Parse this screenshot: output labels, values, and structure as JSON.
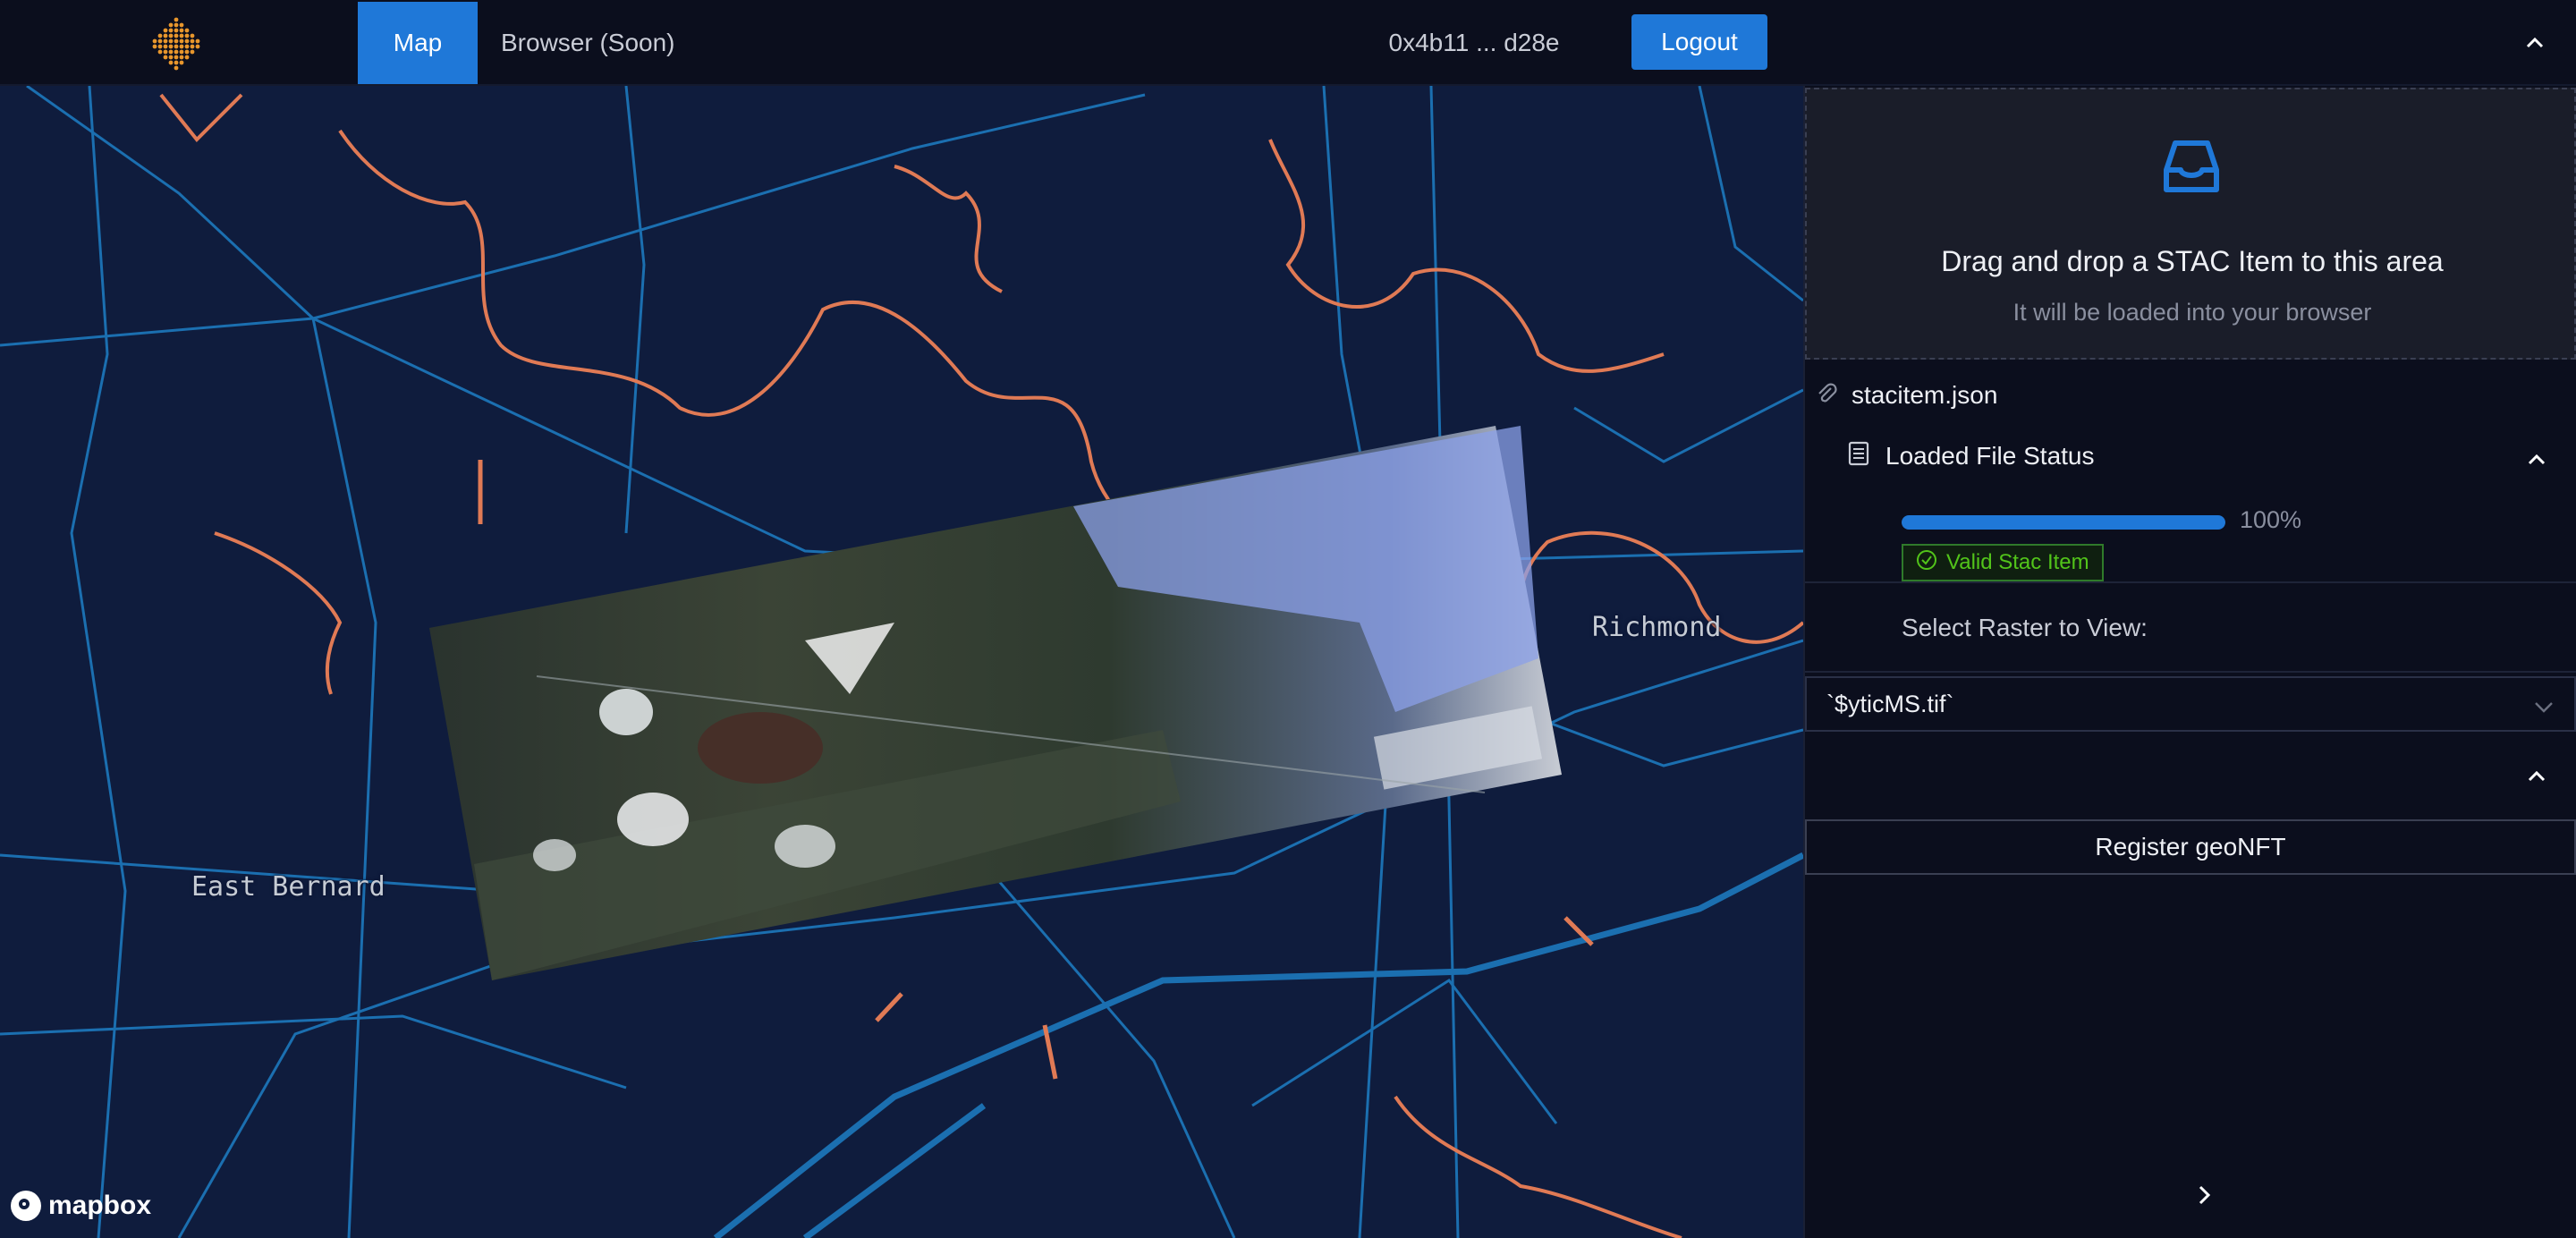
{
  "header": {
    "nav_map": "Map",
    "nav_browser": "Browser (Soon)",
    "wallet_address": "0x4b11 ... d28e",
    "logout_label": "Logout"
  },
  "map": {
    "places": {
      "richmond": "Richmond",
      "east_bernard": "East Bernard"
    },
    "attribution": "mapbox"
  },
  "sidebar": {
    "dropzone": {
      "title": "Drag and drop a STAC Item to this area",
      "subtitle": "It will be loaded into your browser"
    },
    "file_name": "stacitem.json",
    "status_title": "Loaded File Status",
    "progress_percent": 100,
    "progress_label": "100%",
    "valid_badge": "Valid Stac Item",
    "select_label": "Select Raster to View:",
    "raster_selected": "`$yticMS.tif`",
    "register_label": "Register geoNFT"
  },
  "colors": {
    "accent": "#1f78d8",
    "header_bg": "#0b0e1d",
    "map_bg": "#0f1c3d",
    "road": "#1b6fb0",
    "river": "#e07a55",
    "success": "#52c41a"
  },
  "icons": [
    "logo-icon",
    "chevron-up-icon",
    "inbox-icon",
    "paperclip-icon",
    "file-icon",
    "check-circle-icon",
    "chevron-down-icon",
    "chevron-right-icon",
    "mapbox-icon"
  ]
}
